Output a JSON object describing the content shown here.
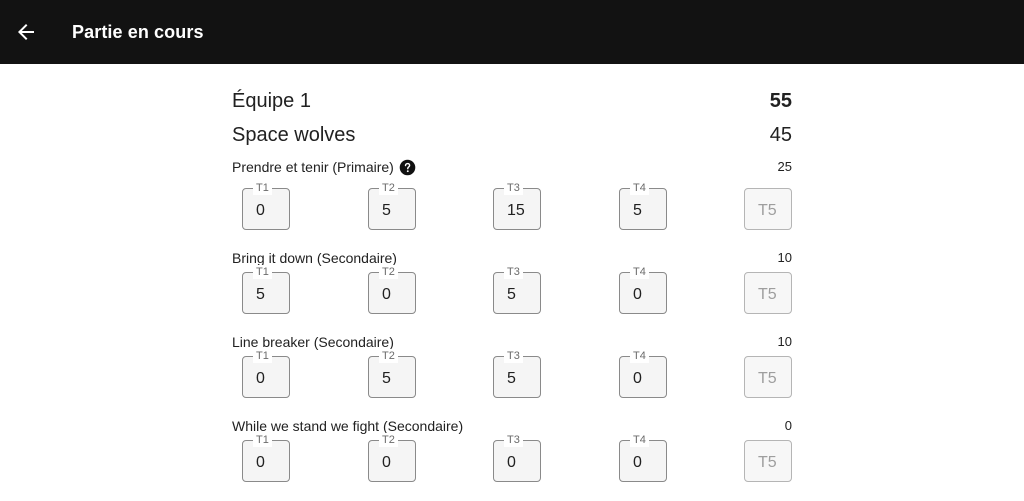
{
  "appbar": {
    "title": "Partie en cours",
    "back_icon": "arrow-left-icon"
  },
  "teams": [
    {
      "name": "Équipe 1",
      "score": "55"
    },
    {
      "name": "Space wolves",
      "score": "45"
    }
  ],
  "missions": [
    {
      "title": "Prendre et tenir (Primaire)",
      "total": "25",
      "has_help": true,
      "turns": [
        {
          "label": "T1",
          "value": "0"
        },
        {
          "label": "T2",
          "value": "5"
        },
        {
          "label": "T3",
          "value": "15"
        },
        {
          "label": "T4",
          "value": "5"
        },
        {
          "label": "",
          "value": "",
          "placeholder": "T5"
        }
      ]
    },
    {
      "title": "Bring it down (Secondaire)",
      "total": "10",
      "turns": [
        {
          "label": "T1",
          "value": "5"
        },
        {
          "label": "T2",
          "value": "0"
        },
        {
          "label": "T3",
          "value": "5"
        },
        {
          "label": "T4",
          "value": "0"
        },
        {
          "label": "",
          "value": "",
          "placeholder": "T5"
        }
      ]
    },
    {
      "title": "Line breaker (Secondaire)",
      "total": "10",
      "turns": [
        {
          "label": "T1",
          "value": "0"
        },
        {
          "label": "T2",
          "value": "5"
        },
        {
          "label": "T3",
          "value": "5"
        },
        {
          "label": "T4",
          "value": "0"
        },
        {
          "label": "",
          "value": "",
          "placeholder": "T5"
        }
      ]
    },
    {
      "title": "While we stand we fight (Secondaire)",
      "total": "0",
      "turns": [
        {
          "label": "T1",
          "value": "0"
        },
        {
          "label": "T2",
          "value": "0"
        },
        {
          "label": "T3",
          "value": "0"
        },
        {
          "label": "T4",
          "value": "0"
        },
        {
          "label": "",
          "value": "",
          "placeholder": "T5"
        }
      ]
    }
  ]
}
